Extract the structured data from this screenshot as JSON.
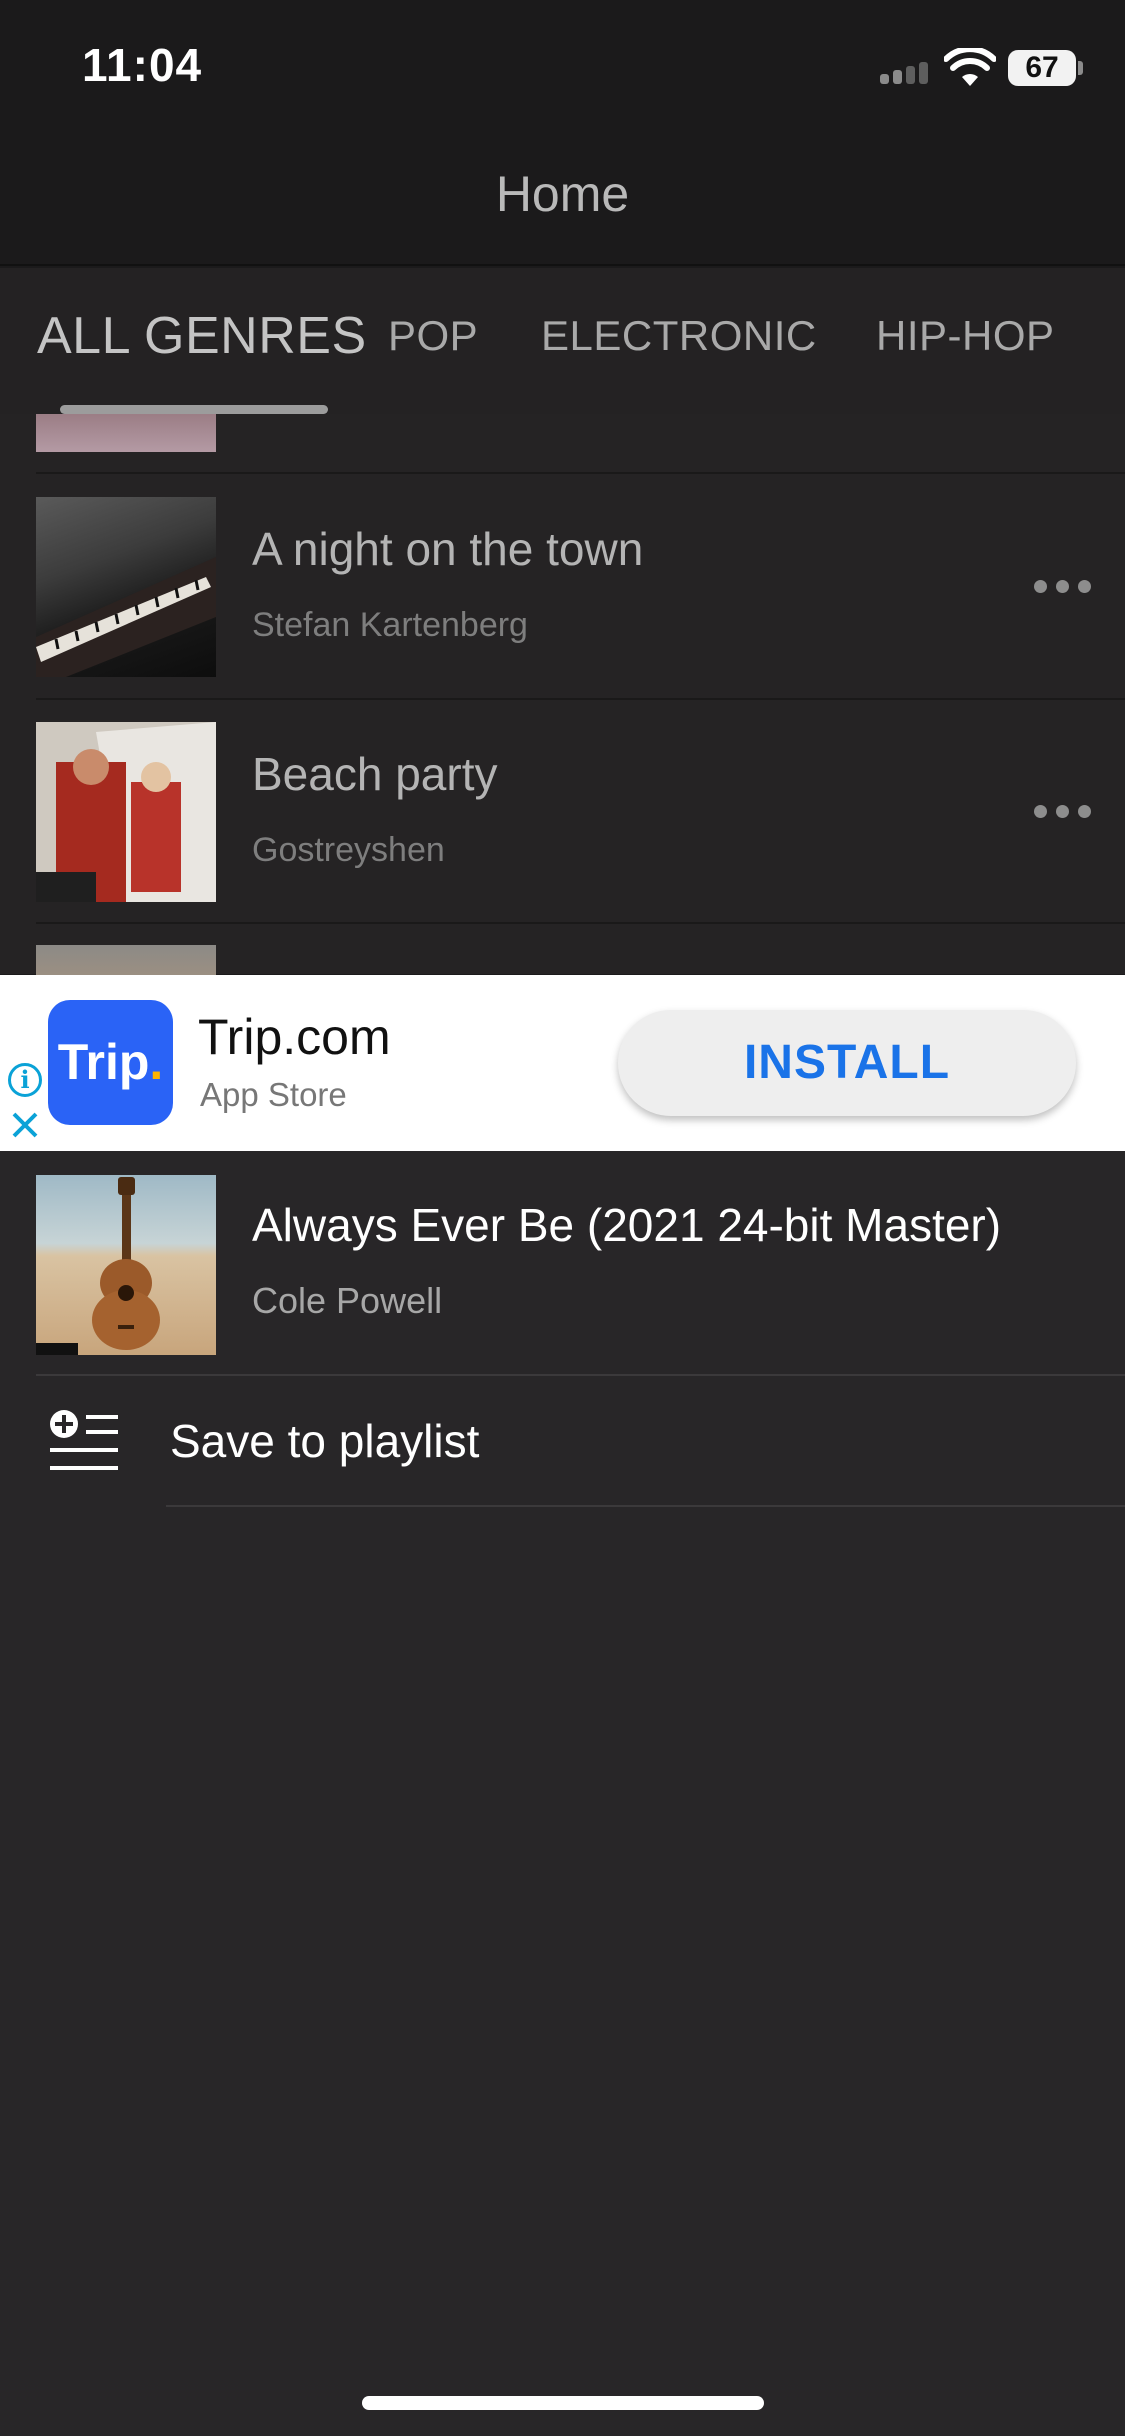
{
  "status_bar": {
    "time": "11:04",
    "battery": "67"
  },
  "nav": {
    "title": "Home"
  },
  "tabs": [
    {
      "label": "ALL GENRES",
      "active": true
    },
    {
      "label": "POP"
    },
    {
      "label": "ELECTRONIC"
    },
    {
      "label": "HIP-HOP"
    }
  ],
  "tracks": [
    {
      "title": "A night on the town",
      "artist": "Stefan Kartenberg"
    },
    {
      "title": "Beach party",
      "artist": "Gostreyshen"
    }
  ],
  "ad": {
    "logo_text": "Trip",
    "logo_dot": ".",
    "app_name": "Trip.com",
    "store": "App Store",
    "cta": "INSTALL",
    "info_icon": "i",
    "colors": {
      "logo_bg": "#2a63f6",
      "cta_text": "#1a73e8",
      "info": "#0aa2d7"
    }
  },
  "sheet": {
    "track_title": "Always Ever Be (2021 24-bit Master)",
    "track_artist": "Cole Powell",
    "actions": [
      {
        "label": "Save to playlist",
        "icon": "playlist-add-icon"
      }
    ]
  }
}
